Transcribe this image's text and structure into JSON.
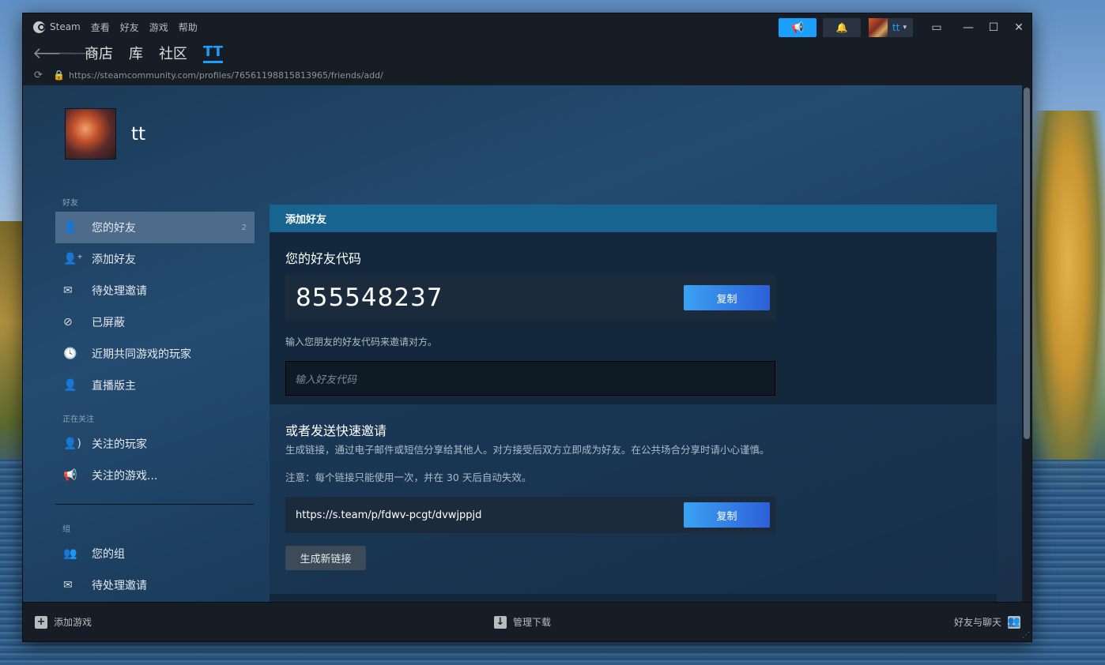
{
  "menu": {
    "app": "Steam",
    "items": [
      "查看",
      "好友",
      "游戏",
      "帮助"
    ]
  },
  "topright": {
    "username": "tt",
    "announce_icon": "megaphone-icon",
    "bell_icon": "bell-icon"
  },
  "nav": {
    "tabs": [
      "商店",
      "库",
      "社区",
      "TT"
    ],
    "active": "TT"
  },
  "address": {
    "url": "https://steamcommunity.com/profiles/76561198815813965/friends/add/"
  },
  "profile": {
    "name": "tt"
  },
  "sidebar": {
    "section_friends": "好友",
    "friends_items": [
      {
        "label": "您的好友",
        "icon": "person-icon",
        "count": "2"
      },
      {
        "label": "添加好友",
        "icon": "person-add-icon"
      },
      {
        "label": "待处理邀请",
        "icon": "envelope-icon"
      },
      {
        "label": "已屏蔽",
        "icon": "block-icon"
      },
      {
        "label": "近期共同游戏的玩家",
        "icon": "clock-icon"
      },
      {
        "label": "直播版主",
        "icon": "person-icon"
      }
    ],
    "section_following": "正在关注",
    "following_items": [
      {
        "label": "关注的玩家",
        "icon": "person-follow-icon"
      },
      {
        "label": "关注的游戏...",
        "icon": "megaphone-icon"
      }
    ],
    "section_groups": "组",
    "group_items": [
      {
        "label": "您的组",
        "icon": "group-icon"
      },
      {
        "label": "待处理邀请",
        "icon": "envelope-icon"
      }
    ]
  },
  "panel": {
    "header": "添加好友",
    "code_title": "您的好友代码",
    "friend_code": "855548237",
    "copy_label": "复制",
    "hint": "输入您朋友的好友代码来邀请对方。",
    "input_placeholder": "输入好友代码",
    "quick_title": "或者发送快速邀请",
    "quick_desc": "生成链接，通过电子邮件或短信分享给其他人。对方接受后双方立即成为好友。在公共场合分享时请小心谨慎。",
    "note": "注意：每个链接只能使用一次，并在 30 天后自动失效。",
    "invite_link": "https://s.team/p/fdwv-pcgt/dvwjppjd",
    "copy_label2": "复制",
    "generate_label": "生成新链接"
  },
  "bottombar": {
    "add_game": "添加游戏",
    "manage_downloads": "管理下载",
    "friends_chat": "好友与聊天"
  }
}
